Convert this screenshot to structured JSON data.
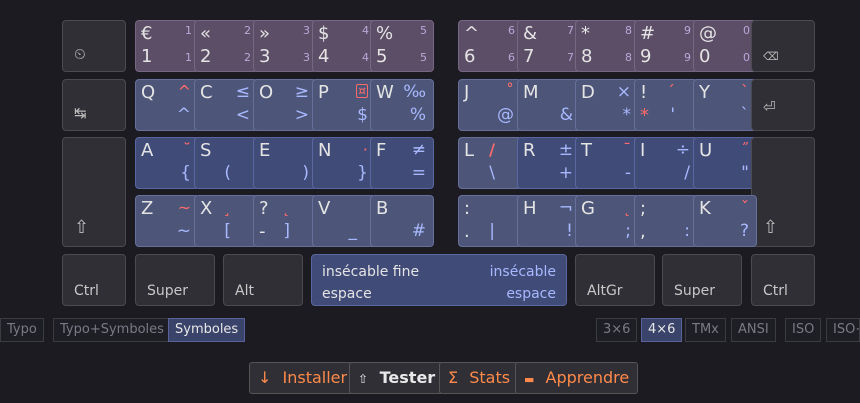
{
  "keys": {
    "k1": {
      "tl": "€",
      "bl": "1",
      "tr": "1",
      "br": "1"
    },
    "k2": {
      "tl": "«",
      "bl": "2",
      "tr": "2",
      "br": "2"
    },
    "k3": {
      "tl": "»",
      "bl": "3",
      "tr": "3",
      "br": "3"
    },
    "k4": {
      "tl": "$",
      "bl": "4",
      "tr": "4",
      "br": "4"
    },
    "k5": {
      "tl": "%",
      "bl": "5",
      "tr": "5",
      "br": "5"
    },
    "k6": {
      "tl": "^",
      "bl": "6",
      "tr": "6",
      "br": "6"
    },
    "k7": {
      "tl": "&",
      "bl": "7",
      "tr": "7",
      "br": "7"
    },
    "k8": {
      "tl": "*",
      "bl": "8",
      "tr": "8",
      "br": "8"
    },
    "k9": {
      "tl": "#",
      "bl": "9",
      "tr": "9",
      "br": "9"
    },
    "k0": {
      "tl": "@",
      "bl": "0",
      "tr": "0",
      "br": "0"
    },
    "Q": {
      "tl": "Q",
      "a": "^",
      "s": "^"
    },
    "C": {
      "tl": "C",
      "s_top": "≤",
      "s": "<"
    },
    "O": {
      "tl": "O",
      "s_top": "≥",
      "s": ">"
    },
    "P": {
      "tl": "P",
      "a": "¤",
      "s": "$"
    },
    "W": {
      "tl": "W",
      "s_top": "‰",
      "s": "%"
    },
    "J": {
      "tl": "J",
      "a": "˚",
      "s": "@"
    },
    "M": {
      "tl": "M",
      "s": "&"
    },
    "D": {
      "tl": "D",
      "s_top": "×",
      "s": "*"
    },
    "excl": {
      "tl": "!",
      "bl": "*",
      "a": "´",
      "a2": "'"
    },
    "Y": {
      "tl": "Y",
      "a": "`",
      "s": "`"
    },
    "A": {
      "tl": "A",
      "a": "˘",
      "s": "{"
    },
    "S": {
      "tl": "S",
      "s": "("
    },
    "E": {
      "tl": "E",
      "s": ")"
    },
    "N": {
      "tl": "N",
      "a": "·",
      "s": "}"
    },
    "F": {
      "tl": "F",
      "s_top": "≠",
      "s": "="
    },
    "L": {
      "tl": "L",
      "a": "/",
      "s": "\\"
    },
    "R": {
      "tl": "R",
      "s_top": "±",
      "s": "+"
    },
    "T": {
      "tl": "T",
      "a": "¯",
      "s": "-"
    },
    "I": {
      "tl": "I",
      "s_top": "÷",
      "s": "/"
    },
    "U": {
      "tl": "U",
      "a": "˝",
      "s": "\""
    },
    "Z": {
      "tl": "Z",
      "a": "~",
      "s": "~"
    },
    "X": {
      "tl": "X",
      "a": "¸",
      "s": "["
    },
    "quest": {
      "tl": "?",
      "bl": "-",
      "a": "˛",
      "s": "]"
    },
    "V": {
      "tl": "V",
      "s": "_"
    },
    "B": {
      "tl": "B",
      "s": "#"
    },
    "colon": {
      "tl": ":",
      "bl": ".",
      "s": "|"
    },
    "H": {
      "tl": "H",
      "s_top": "¬",
      "s": "!"
    },
    "G": {
      "tl": "G",
      "a": "˛",
      "s": ";"
    },
    "semi": {
      "tl": ";",
      "bl": ",",
      "s": ":"
    },
    "K": {
      "tl": "K",
      "a": "ˇ",
      "s": "?"
    }
  },
  "mods": {
    "esc": "⏲",
    "tab": "↹",
    "shift_l": "⇧",
    "shift_r": "⇧",
    "bksp": "⌫",
    "enter": "⏎",
    "ctrl_l": "Ctrl",
    "super_l": "Super",
    "alt": "Alt",
    "altgr": "AltGr",
    "super_r": "Super",
    "ctrl_r": "Ctrl"
  },
  "space": {
    "top_left": "insécable fine",
    "top_right": "insécable",
    "bottom_left": "espace",
    "bottom_right": "espace"
  },
  "layers": [
    "Typo",
    "Typo+Symboles",
    "Symboles"
  ],
  "active_layer": "Symboles",
  "geometries": [
    "3×6",
    "4×6",
    "TMx",
    "ANSI",
    "ISO",
    "ISO+"
  ],
  "active_geometry": "4×6",
  "actions": {
    "install_icon": "↓",
    "install": "Installer",
    "test_icon": "⇧",
    "test": "Tester",
    "stats_icon": "Σ",
    "stats": "Stats",
    "learn_icon": "▬",
    "learn": "Apprendre"
  },
  "colors": {
    "accent": "#ff6b6b",
    "symbol": "#a8b8ff",
    "action": "#ff8a4a"
  }
}
